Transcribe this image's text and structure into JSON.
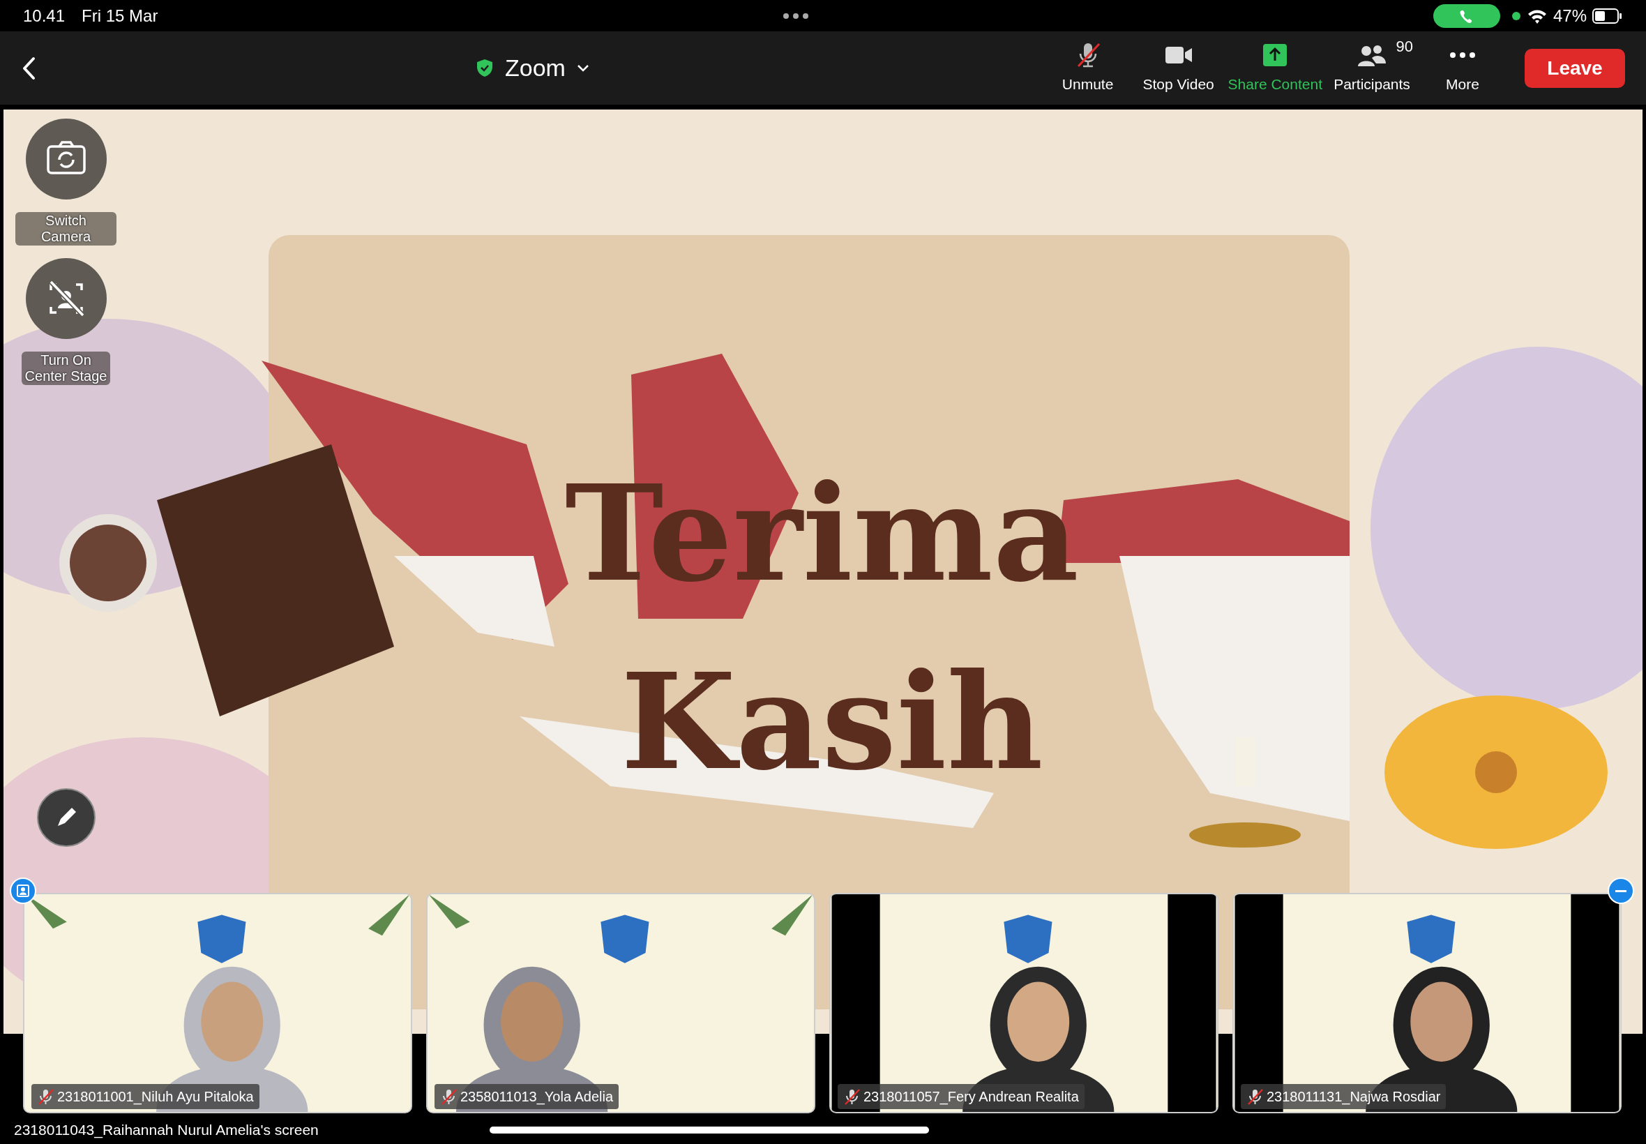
{
  "status_bar": {
    "time": "10.41",
    "date": "Fri 15 Mar",
    "call_active": true,
    "battery": "47%"
  },
  "toolbar": {
    "title": "Zoom",
    "encrypted": true,
    "buttons": [
      {
        "label": "Unmute",
        "kind": "mic-off",
        "active": false
      },
      {
        "label": "Stop Video",
        "kind": "video",
        "active": false
      },
      {
        "label": "Share Content",
        "kind": "share",
        "active": true
      },
      {
        "label": "Participants",
        "kind": "people",
        "active": false,
        "count": "90"
      },
      {
        "label": "More",
        "kind": "more",
        "active": false
      }
    ],
    "leave": "Leave"
  },
  "stage_controls": [
    {
      "kind": "switch-camera",
      "lines": [
        "Switch Camera"
      ]
    },
    {
      "kind": "center-stage",
      "lines": [
        "Turn On",
        "Center Stage"
      ]
    }
  ],
  "slide": {
    "title_lines": [
      "Terima",
      "Kasih"
    ]
  },
  "tiles": [
    {
      "name": "2318011001_Niluh Ayu Pitaloka",
      "muted": true
    },
    {
      "name": "2358011013_Yola Adelia",
      "muted": true
    },
    {
      "name": "2318011057_Fery Andrean Realita",
      "muted": true
    },
    {
      "name": "2318011131_Najwa Rosdiar",
      "muted": true
    }
  ],
  "screen_caption": "2318011043_Raihannah Nurul Amelia's screen"
}
